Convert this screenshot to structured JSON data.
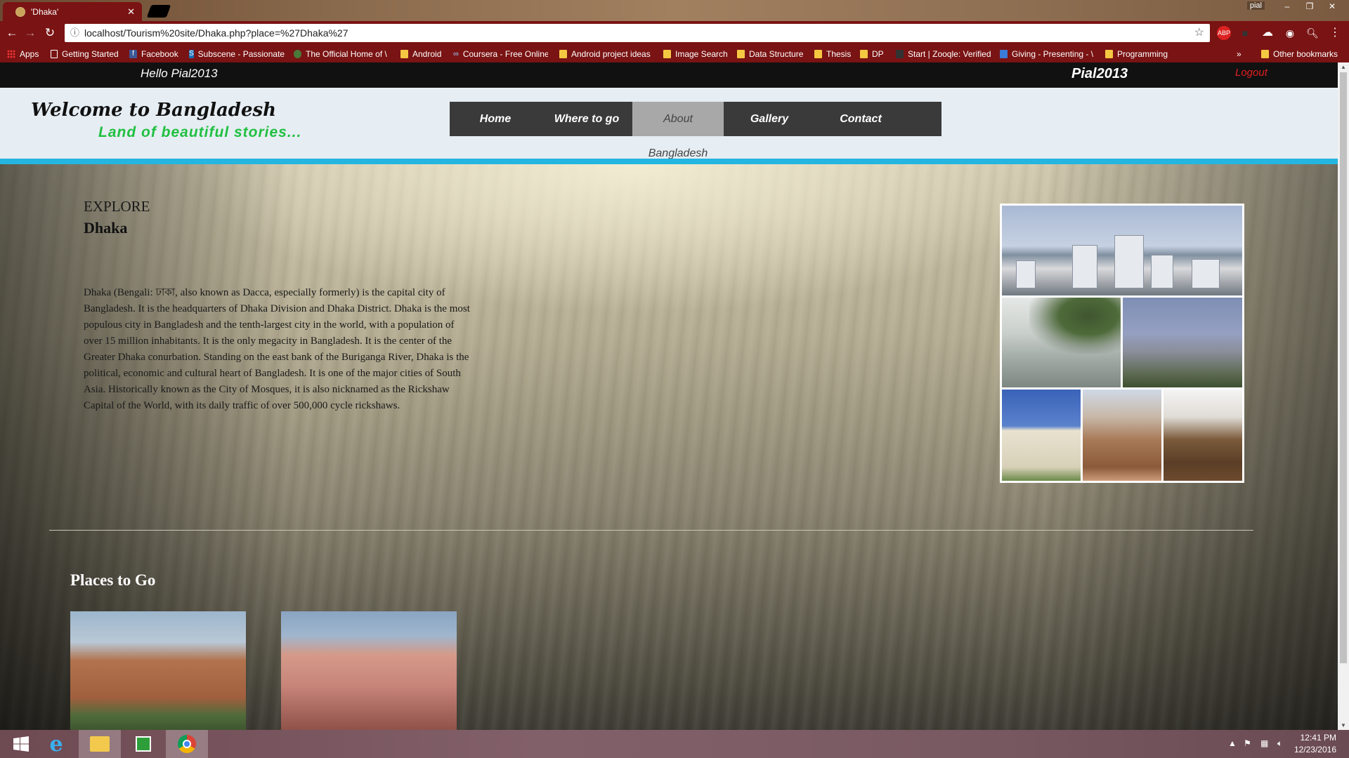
{
  "browser": {
    "tab_title": "'Dhaka'",
    "url": "localhost/Tourism%20site/Dhaka.php?place=%27Dhaka%27",
    "win_user": "pial",
    "bookmarks": [
      "Apps",
      "Getting Started",
      "Facebook",
      "Subscene - Passionate",
      "The Official Home of \\",
      "Android",
      "Coursera - Free Online",
      "Android project ideas",
      "Image Search",
      "Data Structure",
      "Thesis",
      "DP",
      "Start | Zooqle: Verified",
      "Giving - Presenting - \\",
      "Programming"
    ],
    "other_bookmarks": "Other bookmarks",
    "overflow": "»",
    "abp": "ABP"
  },
  "site": {
    "hello": "Hello  Pial2013",
    "username": "Pial2013",
    "logout": "Logout",
    "welcome": "Welcome to Bangladesh",
    "tagline": "Land of beautiful stories...",
    "nav": [
      "Home",
      "Where to go",
      "About Bangladesh",
      "Gallery",
      "Contact"
    ],
    "active_nav": "About Bangladesh",
    "explore": "EXPLORE",
    "city": "Dhaka",
    "description": "Dhaka (Bengali: ঢাকা, also known as Dacca, especially formerly) is the capital city of Bangladesh. It is the headquarters of Dhaka Division and Dhaka District. Dhaka is the most populous city in Bangladesh and the tenth-largest city in the world, with a population of over 15 million inhabitants. It is the only megacity in Bangladesh. It is the center of the Greater Dhaka conurbation. Standing on the east bank of the Buriganga River, Dhaka is the political, economic and cultural heart of Bangladesh. It is one of the major cities of South Asia. Historically known as the City of Mosques, it is also nicknamed as the Rickshaw Capital of the World, with its daily traffic of over 500,000 cycle rickshaws.",
    "places_title": "Places to Go"
  },
  "taskbar": {
    "time": "12:41 PM",
    "date": "12/23/2016"
  },
  "colors": {
    "chrome_red": "#7a1313",
    "accent_blue": "#24b6e0",
    "tagline_green": "#20c040",
    "logout_red": "#e02020"
  }
}
